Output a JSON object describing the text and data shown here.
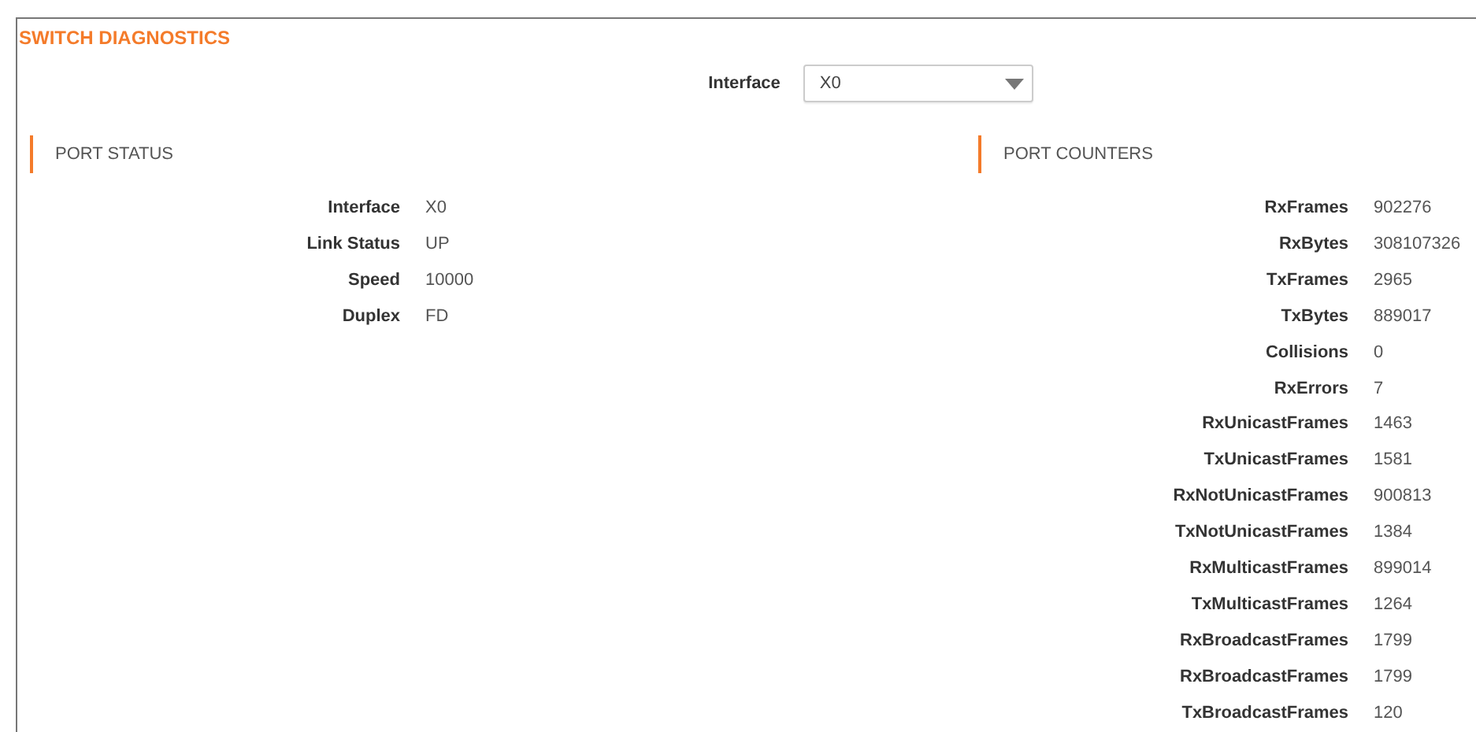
{
  "title": "SWITCH DIAGNOSTICS",
  "interface_select": {
    "label": "Interface",
    "value": "X0"
  },
  "port_status": {
    "heading": "PORT STATUS",
    "rows": [
      {
        "label": "Interface",
        "value": "X0"
      },
      {
        "label": "Link Status",
        "value": "UP"
      },
      {
        "label": "Speed",
        "value": "10000"
      },
      {
        "label": "Duplex",
        "value": "FD"
      }
    ]
  },
  "port_counters": {
    "heading": "PORT COUNTERS",
    "rows": [
      {
        "label": "RxFrames",
        "value": "902276"
      },
      {
        "label": "RxBytes",
        "value": "308107326"
      },
      {
        "label": "TxFrames",
        "value": "2965"
      },
      {
        "label": "TxBytes",
        "value": "889017"
      },
      {
        "label": "Collisions",
        "value": "0"
      },
      {
        "label": "RxErrors",
        "value": "7"
      },
      {
        "label": "RxUnicastFrames",
        "value": "1463"
      },
      {
        "label": "TxUnicastFrames",
        "value": "1581"
      },
      {
        "label": "RxNotUnicastFrames",
        "value": "900813"
      },
      {
        "label": "TxNotUnicastFrames",
        "value": "1384"
      },
      {
        "label": "RxMulticastFrames",
        "value": "899014"
      },
      {
        "label": "TxMulticastFrames",
        "value": "1264"
      },
      {
        "label": "RxBroadcastFrames",
        "value": "1799"
      },
      {
        "label": "RxBroadcastFrames",
        "value": "1799"
      },
      {
        "label": "TxBroadcastFrames",
        "value": "120"
      }
    ]
  }
}
